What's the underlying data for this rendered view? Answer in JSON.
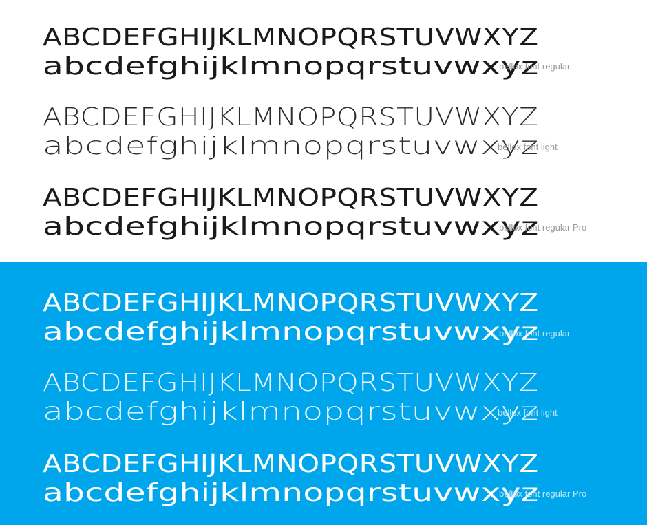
{
  "panels": [
    {
      "theme": "white",
      "background": "#ffffff",
      "text_color": "#1a1a1a",
      "specimens": [
        {
          "uppercase": "ABCDEFGHIJKLMNOPQRSTUVWXYZ",
          "lowercase": "abcdefghijklmnopqrstuvwxyz",
          "caption": "bellox font regular"
        },
        {
          "uppercase": "ABCDEFGHIJKLMNOPQRSTUVWXYZ",
          "lowercase": "abcdefghijklmnopqrstuvwxyz",
          "caption": "bellox font light"
        },
        {
          "uppercase": "ABCDEFGHIJKLMNOPQRSTUVWXYZ",
          "lowercase": "abcdefghijklmnopqrstuvwxyz",
          "caption": "bellox font regular Pro"
        }
      ]
    },
    {
      "theme": "blue",
      "background": "#00a6eb",
      "text_color": "#ffffff",
      "specimens": [
        {
          "uppercase": "ABCDEFGHIJKLMNOPQRSTUVWXYZ",
          "lowercase": "abcdefghijklmnopqrstuvwxyz",
          "caption": "bellox font regular"
        },
        {
          "uppercase": "ABCDEFGHIJKLMNOPQRSTUVWXYZ",
          "lowercase": "abcdefghijklmnopqrstuvwxyz",
          "caption": "bellox font light"
        },
        {
          "uppercase": "ABCDEFGHIJKLMNOPQRSTUVWXYZ",
          "lowercase": "abcdefghijklmnopqrstuvwxyz",
          "caption": "bellox font regular Pro"
        }
      ]
    }
  ]
}
